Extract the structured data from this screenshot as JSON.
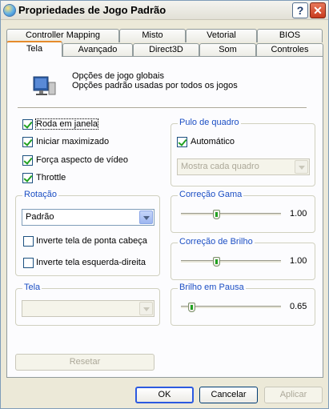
{
  "window": {
    "title": "Propriedades de Jogo Padrão"
  },
  "tabs_row1": [
    "Controller Mapping",
    "Misto",
    "Vetorial",
    "BIOS"
  ],
  "tabs_row2": [
    "Tela",
    "Avançado",
    "Direct3D",
    "Som",
    "Controles"
  ],
  "active_tab": "Tela",
  "header": {
    "line1": "Opções de jogo globais",
    "line2": "Opções padrão usadas por todos os jogos"
  },
  "checkboxes": [
    {
      "label": "Roda em janela",
      "checked": true
    },
    {
      "label": "Iniciar maximizado",
      "checked": true
    },
    {
      "label": "Força aspecto de vídeo",
      "checked": true
    },
    {
      "label": "Throttle",
      "checked": true
    }
  ],
  "rotation": {
    "title": "Rotação",
    "value": "Padrão",
    "options": [
      {
        "label": "Inverte tela de ponta cabeça",
        "checked": false
      },
      {
        "label": "Inverte tela esquerda-direita",
        "checked": false
      }
    ]
  },
  "screen": {
    "title": "Tela",
    "value": ""
  },
  "reset_label": "Resetar",
  "frameskip": {
    "title": "Pulo de quadro",
    "auto_label": "Automático",
    "auto_checked": true,
    "value": "Mostra cada quadro"
  },
  "gamma": {
    "title": "Correção Gama",
    "value": "1.00",
    "level": 0.35
  },
  "brightness": {
    "title": "Correção de Brilho",
    "value": "1.00",
    "level": 0.35
  },
  "pause_brightness": {
    "title": "Brilho em Pausa",
    "value": "0.65",
    "level": 0.1
  },
  "footer": {
    "ok": "OK",
    "cancel": "Cancelar",
    "apply": "Aplicar"
  }
}
